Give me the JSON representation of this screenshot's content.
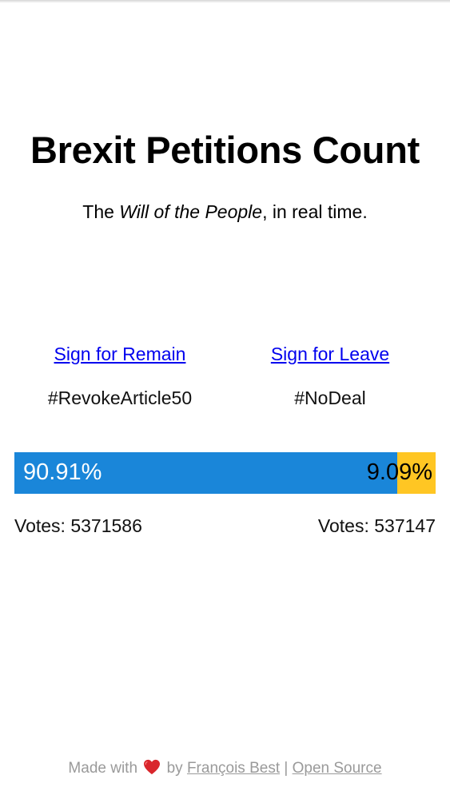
{
  "header": {
    "title": "Brexit Petitions Count",
    "subtitle_prefix": "The ",
    "subtitle_em": "Will of the People",
    "subtitle_suffix": ", in real time."
  },
  "remain": {
    "link_label": "Sign for Remain",
    "hashtag": "#RevokeArticle50",
    "percent_label": "90.91%",
    "fraction": 0.9091,
    "votes_label": "Votes: 5371586",
    "color": "#1a86d9"
  },
  "leave": {
    "link_label": "Sign for Leave",
    "hashtag": "#NoDeal",
    "percent_label": "9.09%",
    "votes_label": "Votes: 537147",
    "color": "#ffc623"
  },
  "footer": {
    "made_with": "Made with",
    "by": "by",
    "author": "François Best",
    "separator": "|",
    "open_source": "Open Source",
    "heart_icon": "heart-icon"
  }
}
